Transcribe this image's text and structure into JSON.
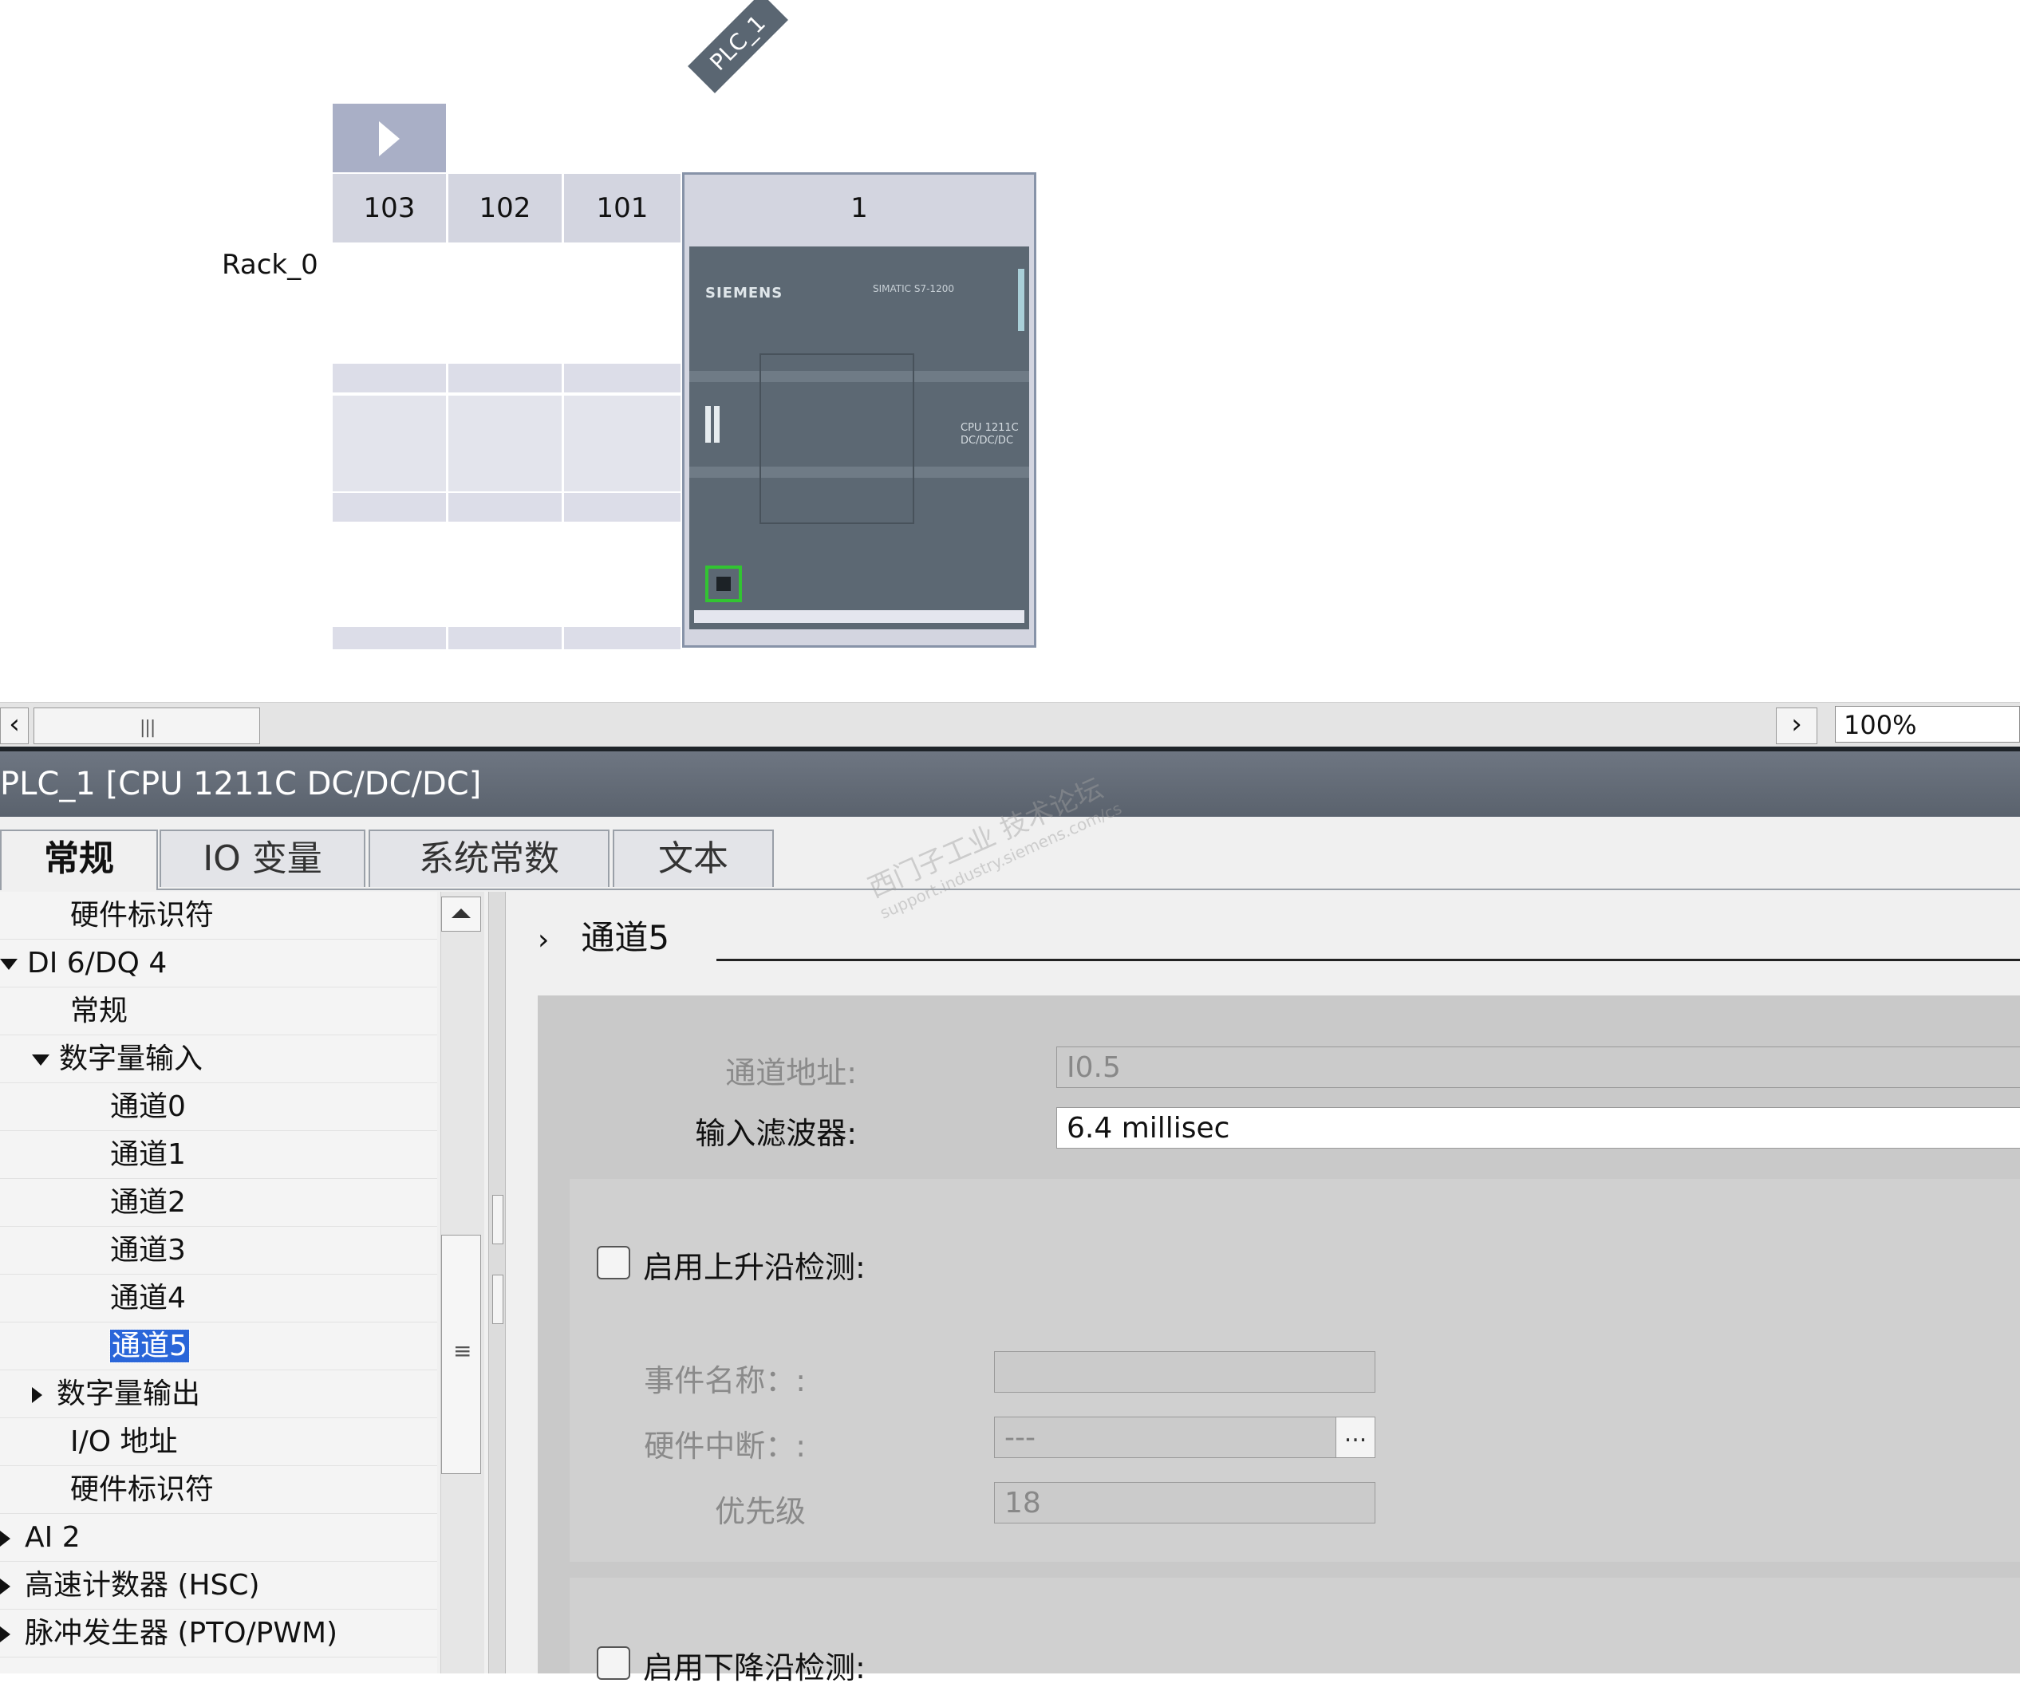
{
  "device_view": {
    "plc_tag": "PLC_1",
    "rack_label": "Rack_0",
    "slots": [
      "103",
      "102",
      "101",
      "1"
    ],
    "cpu": {
      "brand": "SIEMENS",
      "series": "SIMATIC S7-1200",
      "model_line1": "CPU 1211C",
      "model_line2": "DC/DC/DC"
    }
  },
  "scrollbar": {
    "zoom": "100%"
  },
  "inspector": {
    "title": "PLC_1 [CPU 1211C DC/DC/DC]",
    "tabs": [
      "常规",
      "IO 变量",
      "系统常数",
      "文本"
    ],
    "watermark": "西门子工业 技术论坛",
    "watermark_url": "support.industry.siemens.com/cs",
    "tree": [
      {
        "label": "硬件标识符",
        "level": 2,
        "toggle": "none"
      },
      {
        "label": "DI 6/DQ 4",
        "level": 0,
        "toggle": "expanded"
      },
      {
        "label": "常规",
        "level": 2,
        "toggle": "none"
      },
      {
        "label": "数字量输入",
        "level": 1,
        "toggle": "expanded"
      },
      {
        "label": "通道0",
        "level": 3,
        "toggle": "none"
      },
      {
        "label": "通道1",
        "level": 3,
        "toggle": "none"
      },
      {
        "label": "通道2",
        "level": 3,
        "toggle": "none"
      },
      {
        "label": "通道3",
        "level": 3,
        "toggle": "none"
      },
      {
        "label": "通道4",
        "level": 3,
        "toggle": "none"
      },
      {
        "label": "通道5",
        "level": 3,
        "toggle": "none",
        "selected": true
      },
      {
        "label": "数字量输出",
        "level": 1,
        "toggle": "collapsed"
      },
      {
        "label": "I/O 地址",
        "level": 2,
        "toggle": "none"
      },
      {
        "label": "硬件标识符",
        "level": 2,
        "toggle": "none"
      },
      {
        "label": "AI 2",
        "level": 0,
        "toggle": "collapsed"
      },
      {
        "label": "高速计数器 (HSC)",
        "level": 0,
        "toggle": "collapsed"
      },
      {
        "label": "脉冲发生器 (PTO/PWM)",
        "level": 0,
        "toggle": "collapsed"
      }
    ],
    "detail": {
      "section_title": "通道5",
      "channel_address_label": "通道地址:",
      "channel_address_value": "I0.5",
      "input_filter_label": "输入滤波器:",
      "input_filter_value": "6.4 millisec",
      "rising_edge_label": "启用上升沿检测:",
      "rising_edge_checked": false,
      "event_name_label": "事件名称：:",
      "event_name_value": "",
      "hw_interrupt_label": "硬件中断：:",
      "hw_interrupt_value": "---",
      "priority_label": "优先级",
      "priority_value": "18",
      "ellipsis": "...",
      "falling_edge_label": "启用下降沿检测:",
      "falling_edge_checked": false
    }
  },
  "colors": {
    "title_bar": "#5a626d",
    "selection": "#2a66d9",
    "slot_header": "#d3d5e0",
    "cpu_body": "#5c6873",
    "port_green": "#32c432"
  }
}
